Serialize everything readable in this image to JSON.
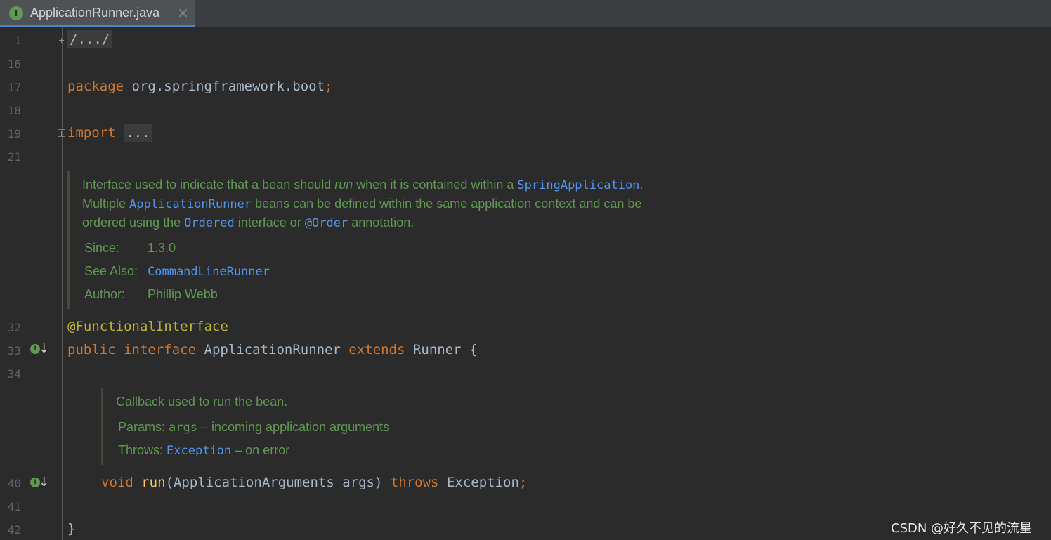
{
  "tab": {
    "icon": "interface-icon",
    "title": "ApplicationRunner.java",
    "close": "×"
  },
  "lines": {
    "l1": "1",
    "l16": "16",
    "l17": "17",
    "l18": "18",
    "l19": "19",
    "l21": "21",
    "l32": "32",
    "l33": "33",
    "l34": "34",
    "l40": "40",
    "l41": "41",
    "l42": "42"
  },
  "code": {
    "header_fold": "/.../",
    "package_kw": "package",
    "package_name": " org.springframework.boot",
    "semicolon": ";",
    "import_kw": "import",
    "import_fold": "...",
    "annotation": "@FunctionalInterface",
    "public_kw": "public",
    "interface_kw": "interface",
    "class_name": "ApplicationRunner",
    "extends_kw": "extends",
    "super_name": "Runner",
    "open_brace": "{",
    "void_kw": "void",
    "method_name": "run",
    "params": "(ApplicationArguments args)",
    "throws_kw": "throws",
    "exception": "Exception",
    "close_brace": "}"
  },
  "class_doc": {
    "l1_a": "Interface used to indicate that a bean should ",
    "l1_run": "run",
    "l1_b": " when it is contained within a ",
    "l1_link": "SpringApplication",
    "l1_c": ".",
    "l2_a": "Multiple ",
    "l2_link": "ApplicationRunner",
    "l2_b": " beans can be defined within the same application context and can be",
    "l3_a": "ordered using the ",
    "l3_link1": "Ordered",
    "l3_b": " interface or ",
    "l3_link2": "@Order",
    "l3_c": " annotation.",
    "since_label": "Since:",
    "since_value": "1.3.0",
    "see_also_label": "See Also:",
    "see_also_link": "CommandLineRunner",
    "author_label": "Author:",
    "author_value": "Phillip Webb"
  },
  "method_doc": {
    "summary": "Callback used to run the bean.",
    "params_label": "Params:",
    "params_name": "args",
    "params_desc": " – incoming application arguments",
    "throws_label": "Throws:",
    "throws_link": "Exception",
    "throws_desc": " – on error"
  },
  "watermark": "CSDN @好久不见的流星"
}
